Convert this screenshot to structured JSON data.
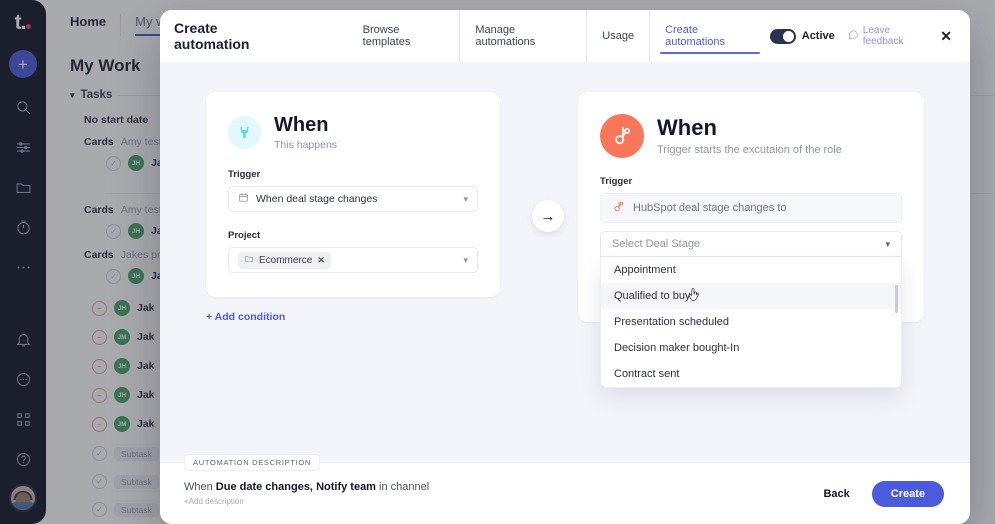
{
  "background": {
    "rail": {
      "logo": "t.",
      "add_label": "+",
      "icons": [
        {
          "name": "search-icon"
        },
        {
          "name": "list-icon"
        },
        {
          "name": "folder-icon"
        },
        {
          "name": "timer-icon"
        },
        {
          "name": "more-icon"
        },
        {
          "name": "bell-icon"
        },
        {
          "name": "chat-icon"
        },
        {
          "name": "apps-grid-icon"
        },
        {
          "name": "help-icon"
        }
      ]
    },
    "tabs": [
      {
        "label": "Home",
        "active": false
      },
      {
        "label": "My work",
        "active": true
      }
    ],
    "page_title": "My Work",
    "section": {
      "label": "Tasks"
    },
    "group_label": "No start date",
    "rows": [
      {
        "label": "Cards",
        "sub": "Amy test",
        "assignee": "JH",
        "name": "Jak",
        "state": "check"
      },
      {
        "label": "Cards",
        "sub": "Amy test",
        "assignee": "JH",
        "name": "Jak",
        "state": "check"
      },
      {
        "label": "Cards",
        "sub": "Jakes pro",
        "assignee": "JH",
        "name": "Jak",
        "state": "check"
      }
    ],
    "blocked_rows": [
      {
        "assignee": "JH",
        "name": "Jak"
      },
      {
        "assignee": "JM",
        "name": "Jak"
      },
      {
        "assignee": "JH",
        "name": "Jak"
      },
      {
        "assignee": "JH",
        "name": "Jak"
      },
      {
        "assignee": "JM",
        "name": "Jak"
      }
    ],
    "subtask_rows": [
      {
        "pill": "Subtask"
      },
      {
        "pill": "Subtask"
      },
      {
        "pill": "Subtask"
      }
    ]
  },
  "modal": {
    "title": "Create automation",
    "nav": [
      {
        "label": "Browse templates",
        "active": false
      },
      {
        "label": "Manage automations",
        "active": false
      },
      {
        "label": "Usage",
        "active": false
      },
      {
        "label": "Create automations",
        "active": true
      }
    ],
    "toggle_label": "Active",
    "toggle_on": true,
    "feedback_label": "Leave feedback",
    "close_label": "✕",
    "accent_color": "#4a5bdb",
    "card_when": {
      "icon": "plug-icon",
      "heading": "When",
      "subheading": "This happens",
      "trigger_label": "Trigger",
      "trigger_value": "When deal stage changes",
      "project_label": "Project",
      "project_chip": "Ecommerce",
      "chip_remove": "✕",
      "chevron": "⌄"
    },
    "add_condition": "+ Add condition",
    "arrow": "→",
    "card_hubspot": {
      "icon": "hubspot-icon",
      "icon_color": "#f8775a",
      "heading": "When",
      "subheading": "Trigger starts the excutaion of the role",
      "trigger_label": "Trigger",
      "trigger_value": "HubSpot deal stage changes to",
      "select_placeholder": "Select Deal Stage",
      "chevron": "⌄",
      "options": [
        "Appointment",
        "Qualified to buy",
        "Presentation scheduled",
        "Decision maker bought-In",
        "Contract sent"
      ],
      "highlighted_option": "Qualified to buy"
    },
    "footer": {
      "tag": "AUTOMATION DESCRIPTION",
      "desc_pre": "When ",
      "desc_b1": "Due date changes,",
      "desc_mid": " ",
      "desc_b2": "Notify team",
      "desc_post": " in channel",
      "add_description": "+Add description",
      "back_label": "Back",
      "create_label": "Create"
    }
  }
}
